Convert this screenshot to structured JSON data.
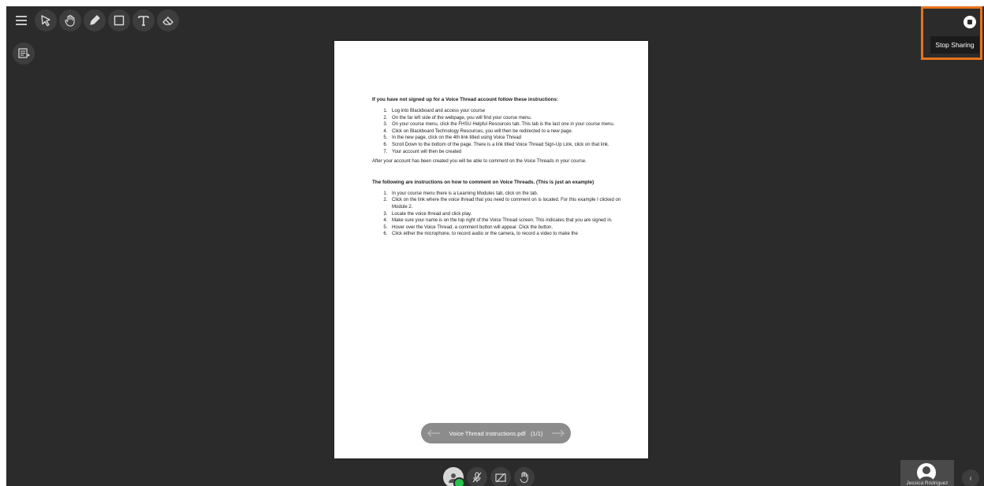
{
  "toolbar": {
    "tools": [
      {
        "icon": "hamburger-menu-icon"
      },
      {
        "icon": "pointer-arrow-icon"
      },
      {
        "icon": "hand-pan-icon"
      },
      {
        "icon": "pencil-icon"
      },
      {
        "icon": "rectangle-icon"
      },
      {
        "icon": "text-tool-icon"
      },
      {
        "icon": "eraser-icon"
      }
    ],
    "secondary_icon": "screen-share-view-icon"
  },
  "document": {
    "section1_title": "If you have not signed up for a Voice Thread account follow these instructions:",
    "section1_steps": [
      "Log into Blackboard and access your course",
      "On the far left side of the webpage, you will find your course menu.",
      "On your course menu, click the FHSU Helpful Resources tab. This tab is the last one in your course menu.",
      "Click on Blackboard Technology Resources, you will then be redirected to a new page.",
      "In the new page, click on the 4th link titled using Voice Thread",
      "Scroll Down to the bottom of the page. There is a link titled Voice Thread Sign-Up Link, click on that link.",
      "Your account will then be created"
    ],
    "section1_footer": "After your account has been created you will be able to comment on the Voice Threads in your course.",
    "section2_title": "The following are instructions on how to comment on Voice Threads. (This is just an example)",
    "section2_steps": [
      "In your course menu there is a Learning Modules tab, click on the tab.",
      "Click on the link where the voice thread that you need to comment on is located. For this example I clicked on Module 2.",
      "Locate the voice thread and click play.",
      "Make sure your name is on the top right of the Voice Thread screen. This indicates that you are signed in.",
      "Hover over the Voice Thread, a comment button will appear. Click the button.",
      "Click either the microphone, to record audio or the camera, to record a video to make the"
    ],
    "file_label": "Voice Thread Instructions.pdf",
    "page_indicator": "(1/1)"
  },
  "share": {
    "stop_label": "Stop Sharing",
    "accent": "#e8731c"
  },
  "controls": {
    "icons": [
      "my-avatar-icon",
      "microphone-muted-icon",
      "camera-off-icon",
      "raise-hand-icon"
    ]
  },
  "participant": {
    "name": "Jessica Rodriguez"
  },
  "collapse_glyph": "‹"
}
